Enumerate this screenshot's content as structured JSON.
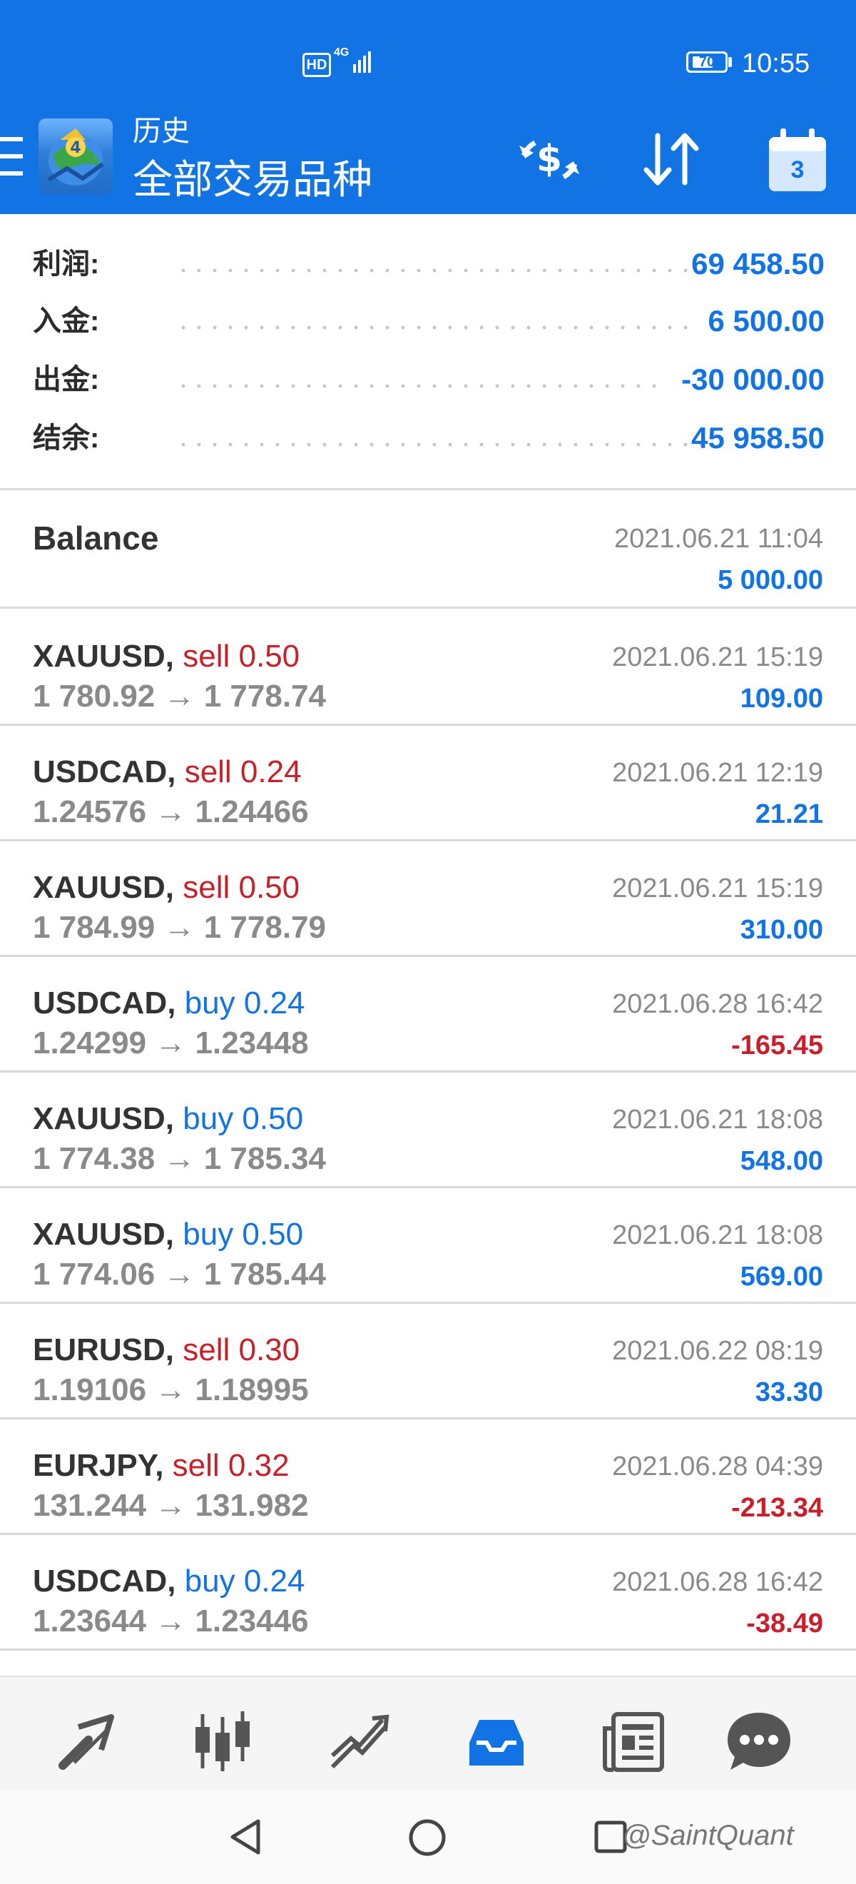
{
  "status_bar": {
    "hd_label": "HD",
    "network_label": "4G",
    "battery_level": "70",
    "time": "10:55"
  },
  "header": {
    "title": "历史",
    "subtitle": "全部交易品种",
    "calendar_day": "3",
    "background_color": "#1273e4"
  },
  "summary": [
    {
      "label": "利润:",
      "value": "69 458.50"
    },
    {
      "label": "入金:",
      "value": "6 500.00"
    },
    {
      "label": "出金:",
      "value": "-30 000.00"
    },
    {
      "label": "结余:",
      "value": "45 958.50"
    }
  ],
  "balance_entry": {
    "title": "Balance",
    "time": "2021.06.21 11:04",
    "amount": "5 000.00"
  },
  "deals": [
    {
      "symbol": "XAUUSD,",
      "type": "sell 0.50",
      "prices": "1 780.92 → 1 778.74",
      "time": "2021.06.21 15:19",
      "profit": "109.00"
    },
    {
      "symbol": "USDCAD,",
      "type": "sell 0.24",
      "prices": "1.24576 → 1.24466",
      "time": "2021.06.21 12:19",
      "profit": "21.21"
    },
    {
      "symbol": "XAUUSD,",
      "type": "sell 0.50",
      "prices": "1 784.99 → 1 778.79",
      "time": "2021.06.21 15:19",
      "profit": "310.00"
    },
    {
      "symbol": "USDCAD,",
      "type": "buy 0.24",
      "prices": "1.24299 → 1.23448",
      "time": "2021.06.28 16:42",
      "profit": "-165.45"
    },
    {
      "symbol": "XAUUSD,",
      "type": "buy 0.50",
      "prices": "1 774.38 → 1 785.34",
      "time": "2021.06.21 18:08",
      "profit": "548.00"
    },
    {
      "symbol": "XAUUSD,",
      "type": "buy 0.50",
      "prices": "1 774.06 → 1 785.44",
      "time": "2021.06.21 18:08",
      "profit": "569.00"
    },
    {
      "symbol": "EURUSD,",
      "type": "sell 0.30",
      "prices": "1.19106 → 1.18995",
      "time": "2021.06.22 08:19",
      "profit": "33.30"
    },
    {
      "symbol": "EURJPY,",
      "type": "sell 0.32",
      "prices": "131.244 → 131.982",
      "time": "2021.06.28 04:39",
      "profit": "-213.34"
    },
    {
      "symbol": "USDCAD,",
      "type": "buy 0.24",
      "prices": "1.23644 → 1.23446",
      "time": "2021.06.28 16:42",
      "profit": "-38.49"
    }
  ],
  "colors": {
    "accent": "#1273e4",
    "sell": "#c8202a",
    "buy": "#1273e4",
    "loss": "#c8202a",
    "gain": "#1273e4"
  },
  "bottom_nav": [
    {
      "icon": "quotes-icon",
      "active": false
    },
    {
      "icon": "chart-icon",
      "active": false
    },
    {
      "icon": "trade-icon",
      "active": false
    },
    {
      "icon": "history-icon",
      "active": true
    },
    {
      "icon": "news-icon",
      "active": false
    },
    {
      "icon": "chat-icon",
      "active": false
    }
  ],
  "watermark": "@SaintQuant"
}
